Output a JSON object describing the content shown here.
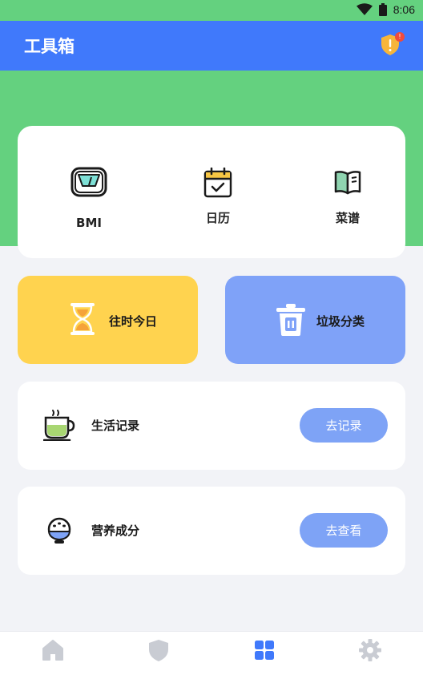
{
  "status_bar": {
    "time": "8:06",
    "icons": [
      "wifi-icon",
      "battery-icon"
    ]
  },
  "app_bar": {
    "title": "工具箱",
    "alert_badge": "!",
    "alert_icon": "shield-alert-icon"
  },
  "tools": [
    {
      "label": "BMI",
      "icon": "scale-icon"
    },
    {
      "label": "日历",
      "icon": "calendar-icon"
    },
    {
      "label": "菜谱",
      "icon": "book-icon"
    }
  ],
  "features": [
    {
      "label": "往时今日",
      "icon": "hourglass-icon"
    },
    {
      "label": "垃圾分类",
      "icon": "trash-icon"
    }
  ],
  "list_items": [
    {
      "label": "生活记录",
      "button": "去记录",
      "icon": "tea-cup-icon"
    },
    {
      "label": "营养成分",
      "button": "去查看",
      "icon": "rice-bowl-icon"
    }
  ],
  "nav": [
    {
      "icon": "home-icon",
      "active": false
    },
    {
      "icon": "shield-icon",
      "active": false
    },
    {
      "icon": "grid-icon",
      "active": true
    },
    {
      "icon": "gear-icon",
      "active": false
    }
  ],
  "colors": {
    "primary": "#4079fb",
    "green": "#64d17f",
    "yellow_card": "#ffd34f",
    "blue_card": "#7fa2f8",
    "button": "#7ea3f6",
    "nav_inactive": "#c9ccd3"
  }
}
